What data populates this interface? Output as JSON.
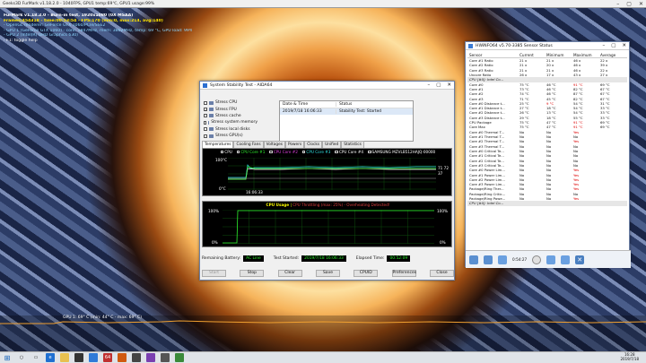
{
  "desktop": {
    "title": "Geeks3D FurMark v1.18.2.0 - 1040FPS, GPU1 temp:69℃, GPU1 usage:99%",
    "overlay_lines": [
      "FurMark v1.18.2.0 - Burn-in test, 1920x1080 (0X MSAA)",
      "Frames:454318 - time:00:53:54 - FPS:170 (min:0, max:214, avg:140)",
      "- OpenGL renderer: GeForce GTX 1060/PCIe/SSE2",
      "- GPU 1 (GeForce GTX 1060) - core: 1847MHz, mem: 3802MHz, temp: 69 °C, GPU load: 99%, GPU power: 100.0% TDP, fan: 46%",
      "- GPU 2 (Intel(R) UHD Graphics 630)",
      "- F1: toggle help"
    ],
    "gpu_graph_label": "GPU 1: 69° C (min: 44° C - max: 69° C)"
  },
  "aida": {
    "title": "System Stability Test - AIDA64",
    "stress_items": [
      {
        "label": "Stress CPU",
        "checked": false
      },
      {
        "label": "Stress FPU",
        "checked": true
      },
      {
        "label": "Stress cache",
        "checked": false
      },
      {
        "label": "Stress system memory",
        "checked": false
      },
      {
        "label": "Stress local disks",
        "checked": false
      },
      {
        "label": "Stress GPU(s)",
        "checked": false
      }
    ],
    "log": {
      "col_date": "Date & Time",
      "col_status": "Status",
      "row_date": "2019/7/18 16:06:33",
      "row_status": "Stability Test: Started"
    },
    "tabs": [
      "Temperatures",
      "Cooling Fans",
      "Voltages",
      "Powers",
      "Clocks",
      "Unified",
      "Statistics"
    ],
    "temp_legend": [
      "CPU",
      "CPU Core #1",
      "CPU Core #2",
      "CPU Core #3",
      "CPU Core #4",
      "SAMSUNG MZVLB512HAJQ-00000"
    ],
    "temp_axis_top": "100°C",
    "temp_axis_bottom": "0°C",
    "temp_time": "16:06:33",
    "temp_value_a": "71 72",
    "temp_value_b": "37",
    "cpu_title": "CPU Usage",
    "cpu_throttle": "CPU Throttling (max: 25%) - Overheating Detected!",
    "cpu_axis_top": "100%",
    "cpu_axis_bottom": "0%",
    "cpu_right_top": "100%",
    "cpu_right_bottom": "0%",
    "battery_label": "Remaining Battery:",
    "battery_value": "AC Line",
    "started_label": "Test Started:",
    "started_value": "2019/7/18 16:06:33",
    "elapsed_label": "Elapsed Time:",
    "elapsed_value": "00:52:09",
    "buttons": [
      "Start",
      "Stop",
      "Clear",
      "Save",
      "CPUID",
      "Preferences",
      "Close"
    ]
  },
  "hwinfo": {
    "title": "HWiNFO64 v5.70-3385 Sensor Status",
    "columns": [
      "Sensor",
      "Current",
      "Minimum",
      "Maximum",
      "Average"
    ],
    "rows": [
      {
        "name": "Core #1 Ratio",
        "cur": "21 x",
        "min": "21 x",
        "max": "46 x",
        "avg": "22 x"
      },
      {
        "name": "Core #2 Ratio",
        "cur": "21 x",
        "min": "20 x",
        "max": "46 x",
        "avg": "39 x"
      },
      {
        "name": "Core #3 Ratio",
        "cur": "21 x",
        "min": "21 x",
        "max": "46 x",
        "avg": "22 x"
      },
      {
        "name": "Uncore Ratio",
        "cur": "26 x",
        "min": "17 x",
        "max": "43 x",
        "avg": "27 x"
      },
      {
        "section": "CPU [#0]: Intel Co..."
      },
      {
        "name": "Core #0",
        "cur": "75 °C",
        "min": "46 °C",
        "max": "91 °C",
        "avg": "69 °C",
        "maxred": true
      },
      {
        "name": "Core #1",
        "cur": "73 °C",
        "min": "46 °C",
        "max": "82 °C",
        "avg": "67 °C"
      },
      {
        "name": "Core #2",
        "cur": "74 °C",
        "min": "46 °C",
        "max": "87 °C",
        "avg": "67 °C"
      },
      {
        "name": "Core #3",
        "cur": "71 °C",
        "min": "45 °C",
        "max": "82 °C",
        "avg": "67 °C"
      },
      {
        "name": "Core #0 Distance t...",
        "cur": "25 °C",
        "min": "9 °C",
        "max": "54 °C",
        "avg": "31 °C",
        "minred": true
      },
      {
        "name": "Core #1 Distance t...",
        "cur": "27 °C",
        "min": "18 °C",
        "max": "54 °C",
        "avg": "33 °C"
      },
      {
        "name": "Core #2 Distance t...",
        "cur": "26 °C",
        "min": "13 °C",
        "max": "54 °C",
        "avg": "33 °C"
      },
      {
        "name": "Core #3 Distance t...",
        "cur": "29 °C",
        "min": "18 °C",
        "max": "55 °C",
        "avg": "33 °C"
      },
      {
        "name": "CPU Package",
        "cur": "75 °C",
        "min": "47 °C",
        "max": "91 °C",
        "avg": "69 °C",
        "maxred": true
      },
      {
        "name": "Core Max",
        "cur": "75 °C",
        "min": "47 °C",
        "max": "91 °C",
        "avg": "69 °C",
        "maxred": true
      },
      {
        "name": "Core #0 Thermal T...",
        "cur": "No",
        "min": "No",
        "max": "Yes",
        "avg": "",
        "maxred": true
      },
      {
        "name": "Core #1 Thermal T...",
        "cur": "No",
        "min": "No",
        "max": "No",
        "avg": ""
      },
      {
        "name": "Core #2 Thermal T...",
        "cur": "No",
        "min": "No",
        "max": "Yes",
        "avg": "",
        "maxred": true
      },
      {
        "name": "Core #3 Thermal T...",
        "cur": "No",
        "min": "No",
        "max": "No",
        "avg": ""
      },
      {
        "name": "Core #0 Critical Te...",
        "cur": "No",
        "min": "No",
        "max": "No",
        "avg": ""
      },
      {
        "name": "Core #1 Critical Te...",
        "cur": "No",
        "min": "No",
        "max": "No",
        "avg": ""
      },
      {
        "name": "Core #2 Critical Te...",
        "cur": "No",
        "min": "No",
        "max": "No",
        "avg": ""
      },
      {
        "name": "Core #3 Critical Te...",
        "cur": "No",
        "min": "No",
        "max": "No",
        "avg": ""
      },
      {
        "name": "Core #0 Power Lim...",
        "cur": "No",
        "min": "No",
        "max": "Yes",
        "avg": "",
        "maxred": true
      },
      {
        "name": "Core #1 Power Lim...",
        "cur": "No",
        "min": "No",
        "max": "Yes",
        "avg": "",
        "maxred": true
      },
      {
        "name": "Core #2 Power Lim...",
        "cur": "No",
        "min": "No",
        "max": "Yes",
        "avg": "",
        "maxred": true
      },
      {
        "name": "Core #3 Power Lim...",
        "cur": "No",
        "min": "No",
        "max": "Yes",
        "avg": "",
        "maxred": true
      },
      {
        "name": "Package/Ring Ther...",
        "cur": "No",
        "min": "No",
        "max": "Yes",
        "avg": "",
        "maxred": true
      },
      {
        "name": "Package/Ring Critic...",
        "cur": "No",
        "min": "No",
        "max": "No",
        "avg": ""
      },
      {
        "name": "Package/Ring Powe...",
        "cur": "No",
        "min": "No",
        "max": "Yes",
        "avg": "",
        "maxred": true
      },
      {
        "section": "CPU [#0]: Intel Co..."
      }
    ],
    "toolbar_time": "0:54:27"
  },
  "taskbar": {
    "time": "16:28",
    "date": "2019/7/18",
    "badge": "64"
  }
}
